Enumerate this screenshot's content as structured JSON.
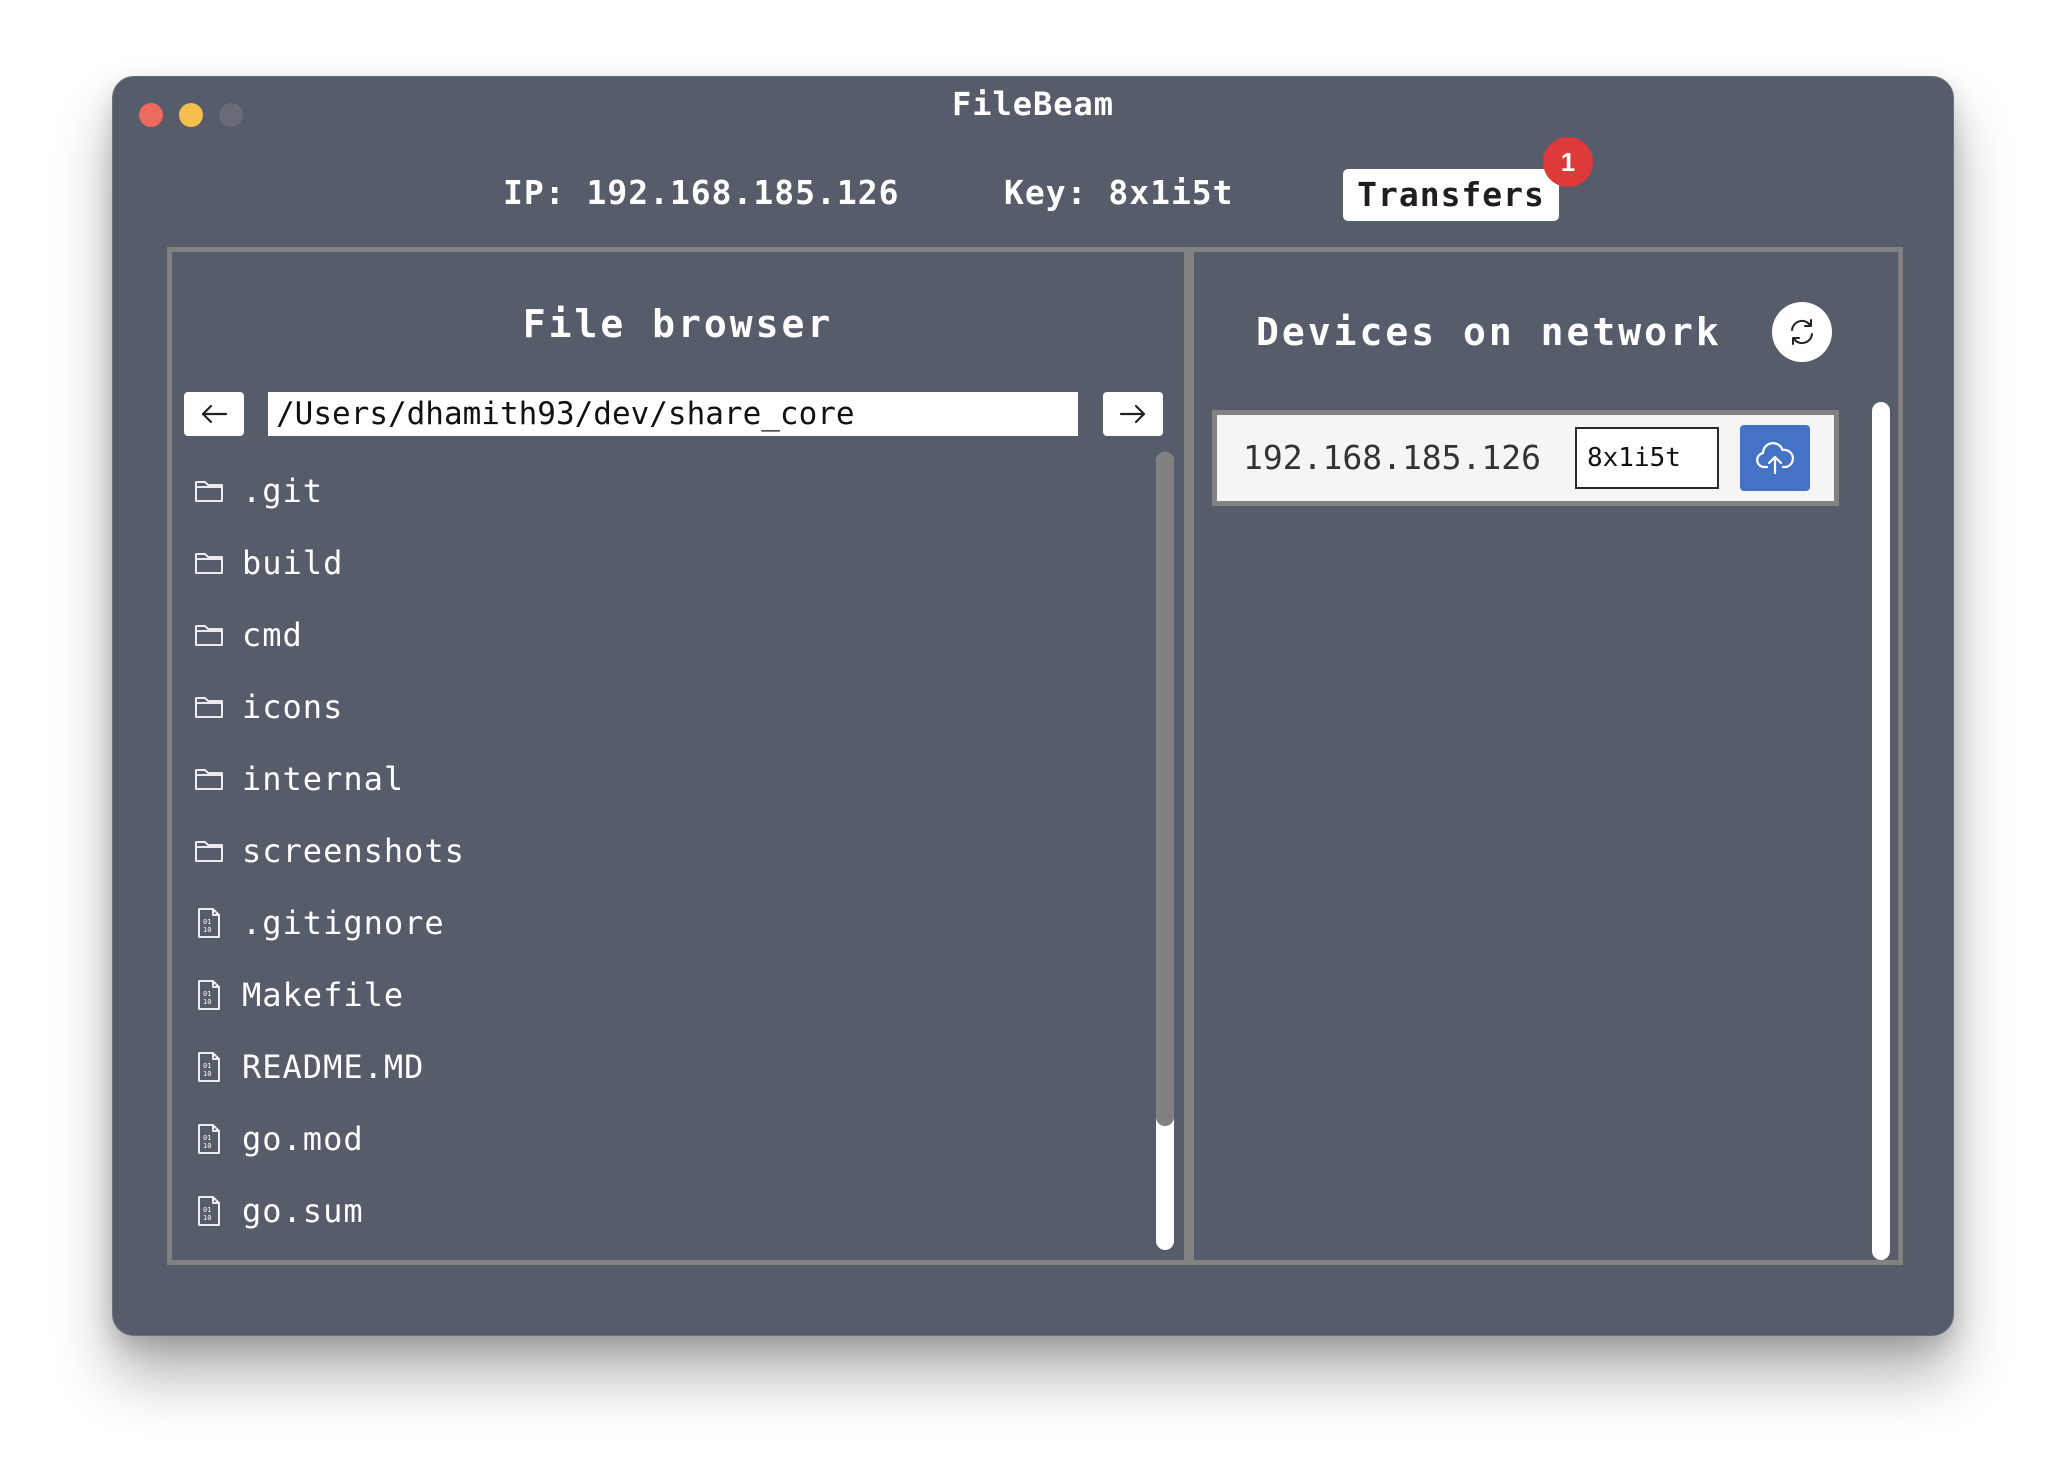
{
  "window": {
    "title": "FileBeam"
  },
  "header": {
    "ip_text": "IP: 192.168.185.126",
    "key_text": "Key: 8x1i5t",
    "transfers_label": "Transfers",
    "transfers_badge": "1"
  },
  "file_browser": {
    "title": "File browser",
    "path": "/Users/dhamith93/dev/share_core",
    "back_icon": "arrow-left-icon",
    "forward_icon": "arrow-right-icon",
    "items": [
      {
        "name": ".git",
        "type": "folder"
      },
      {
        "name": "build",
        "type": "folder"
      },
      {
        "name": "cmd",
        "type": "folder"
      },
      {
        "name": "icons",
        "type": "folder"
      },
      {
        "name": "internal",
        "type": "folder"
      },
      {
        "name": "screenshots",
        "type": "folder"
      },
      {
        "name": ".gitignore",
        "type": "file"
      },
      {
        "name": "Makefile",
        "type": "file"
      },
      {
        "name": "README.MD",
        "type": "file"
      },
      {
        "name": "go.mod",
        "type": "file"
      },
      {
        "name": "go.sum",
        "type": "file"
      }
    ]
  },
  "devices": {
    "title": "Devices on network",
    "refresh_icon": "refresh-icon",
    "list": [
      {
        "ip": "192.168.185.126",
        "key": "8x1i5t",
        "action_icon": "cloud-upload-icon"
      }
    ]
  },
  "colors": {
    "window_bg": "#575c6b",
    "pane_border": "#828282",
    "badge": "#de3a3a",
    "upload_button": "#4472c4"
  }
}
